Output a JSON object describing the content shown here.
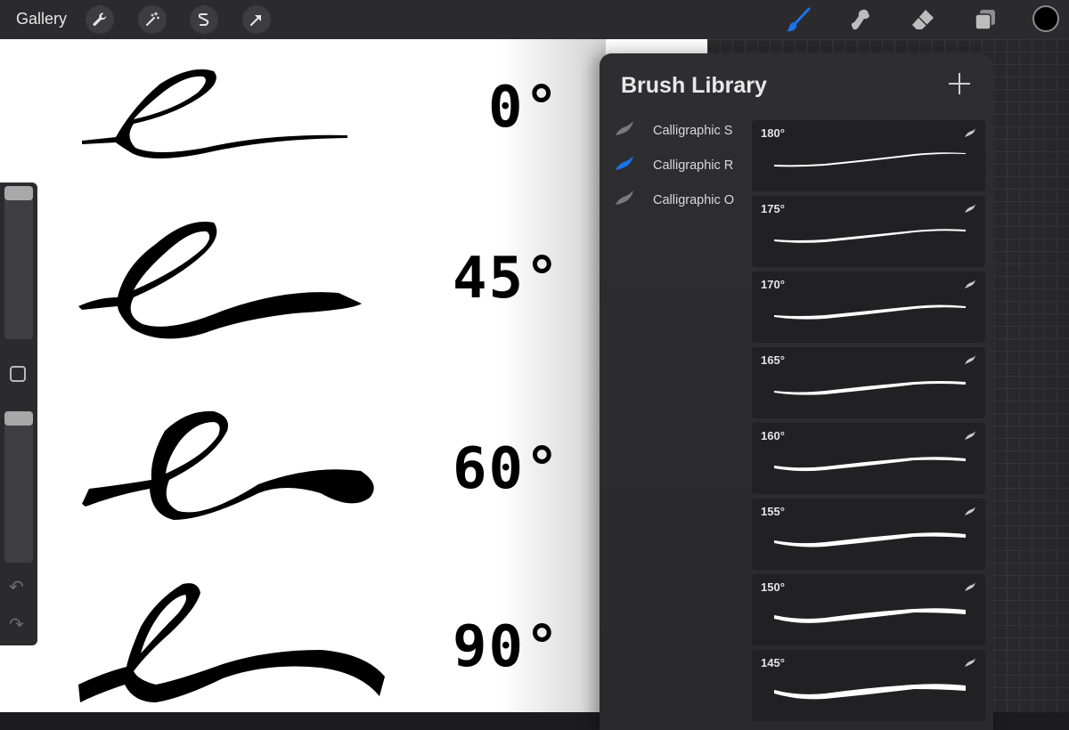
{
  "topbar": {
    "gallery_label": "Gallery",
    "left_tools": [
      {
        "name": "wrench-icon"
      },
      {
        "name": "magic-wand-icon"
      },
      {
        "name": "selection-icon"
      },
      {
        "name": "transform-arrow-icon"
      }
    ],
    "right_tools": [
      {
        "name": "brush-icon",
        "active": true
      },
      {
        "name": "smudge-icon",
        "active": false
      },
      {
        "name": "eraser-icon",
        "active": false
      },
      {
        "name": "layers-icon",
        "active": false
      }
    ],
    "color_swatch": "#000000",
    "accent_color": "#1a73e8"
  },
  "canvas": {
    "angles": [
      "0°",
      "45°",
      "60°",
      "90°"
    ]
  },
  "sidebar": {
    "undo_icon": "undo-icon",
    "redo_icon": "redo-icon"
  },
  "brush_library": {
    "title": "Brush Library",
    "sets": [
      {
        "label": "Calligraphic S",
        "selected": false
      },
      {
        "label": "Calligraphic R",
        "selected": true
      },
      {
        "label": "Calligraphic O",
        "selected": false
      }
    ],
    "brushes": [
      {
        "name": "180°"
      },
      {
        "name": "175°"
      },
      {
        "name": "170°"
      },
      {
        "name": "165°"
      },
      {
        "name": "160°"
      },
      {
        "name": "155°"
      },
      {
        "name": "150°"
      },
      {
        "name": "145°"
      }
    ]
  }
}
